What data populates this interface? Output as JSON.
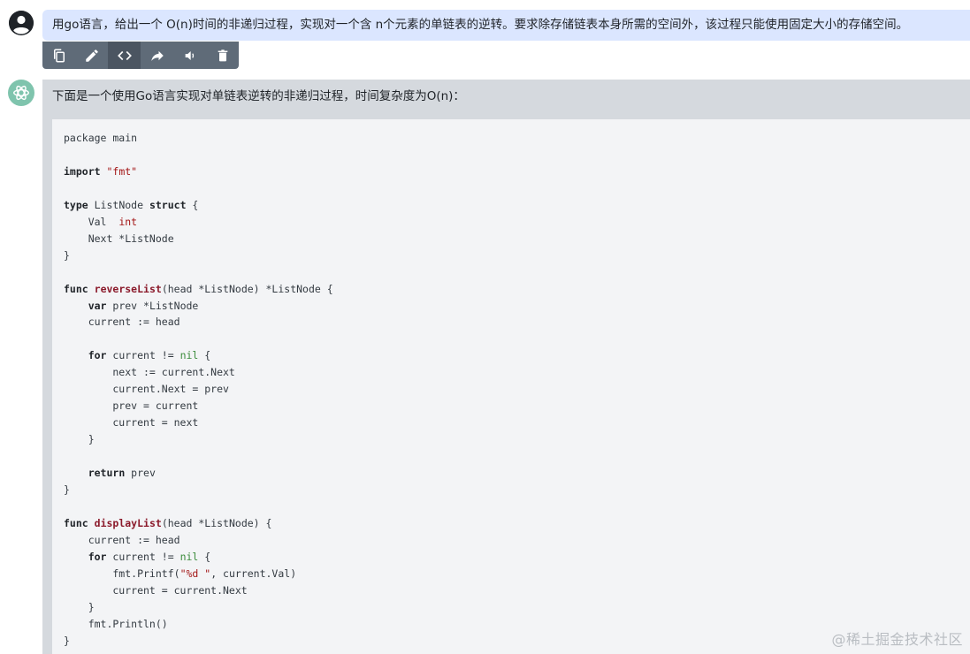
{
  "user_message": {
    "text": "用go语言，给出一个 O(n)时间的非递归过程，实现对一个含 n个元素的单链表的逆转。要求除存储链表本身所需的空间外，该过程只能使用固定大小的存储空间。"
  },
  "toolbar": {
    "buttons": [
      {
        "icon": "copy-icon"
      },
      {
        "icon": "edit-icon"
      },
      {
        "icon": "code-icon",
        "active": true
      },
      {
        "icon": "share-icon"
      },
      {
        "icon": "speaker-icon"
      },
      {
        "icon": "trash-icon"
      }
    ]
  },
  "assistant_message": {
    "intro": "下面是一个使用Go语言实现对单链表逆转的非递归过程，时间复杂度为O(n)："
  },
  "code": {
    "line_1": "package main",
    "line_2": "import",
    "line_2_str": "\"fmt\"",
    "line_3_kw1": "type",
    "line_3_name": " ListNode ",
    "line_3_kw2": "struct",
    "line_3_end": " {",
    "line_4_name": "    Val  ",
    "line_4_type": "int",
    "line_5": "    Next *ListNode",
    "line_6": "}",
    "fn1_kw": "func",
    "fn1_name": "reverseList",
    "fn1_sig": "(head *ListNode) *ListNode {",
    "fn1_l1_kw": "var",
    "fn1_l1_rest": " prev *ListNode",
    "fn1_l2": "    current := head",
    "fn1_l3_kw": "for",
    "fn1_l3_mid": " current != ",
    "fn1_l3_nil": "nil",
    "fn1_l3_end": " {",
    "fn1_l4": "        next := current.Next",
    "fn1_l5": "        current.Next = prev",
    "fn1_l6": "        prev = current",
    "fn1_l7": "        current = next",
    "fn1_l8": "    }",
    "fn1_l9_kw": "return",
    "fn1_l9_rest": " prev",
    "fn1_end": "}",
    "fn2_kw": "func",
    "fn2_name": "displayList",
    "fn2_sig": "(head *ListNode) {",
    "fn2_l1": "    current := head",
    "fn2_l2_kw": "for",
    "fn2_l2_mid": " current != ",
    "fn2_l2_nil": "nil",
    "fn2_l2_end": " {",
    "fn2_l3_pre": "        fmt.Printf(",
    "fn2_l3_str": "\"%d \"",
    "fn2_l3_post": ", current.Val)",
    "fn2_l4": "        current = current.Next",
    "fn2_l5": "    }",
    "fn2_l6": "    fmt.Println()",
    "fn2_end": "}"
  },
  "watermark": "@稀土掘金技术社区"
}
